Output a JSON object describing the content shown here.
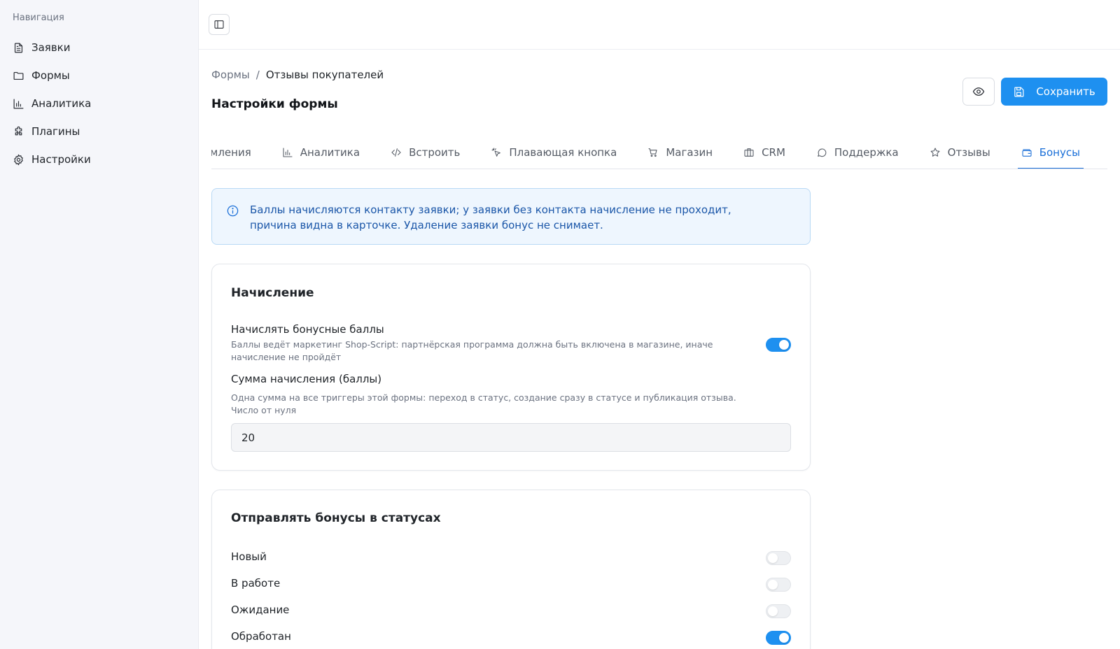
{
  "sidebar": {
    "title": "Навигация",
    "items": [
      {
        "label": "Заявки",
        "icon": "document-icon"
      },
      {
        "label": "Формы",
        "icon": "folder-icon"
      },
      {
        "label": "Аналитика",
        "icon": "bar-chart-icon"
      },
      {
        "label": "Плагины",
        "icon": "puzzle-icon"
      },
      {
        "label": "Настройки",
        "icon": "gear-icon"
      }
    ]
  },
  "header": {
    "breadcrumb": {
      "parent": "Формы",
      "separator": "/",
      "current": "Отзывы покупателей"
    },
    "title": "Настройки формы",
    "save_label": "Сохранить"
  },
  "tabs": [
    {
      "label": "мления",
      "icon": ""
    },
    {
      "label": "Аналитика",
      "icon": "bar-chart-icon"
    },
    {
      "label": "Встроить",
      "icon": "code-icon"
    },
    {
      "label": "Плавающая кнопка",
      "icon": "pointer-click-icon"
    },
    {
      "label": "Магазин",
      "icon": "cart-icon"
    },
    {
      "label": "CRM",
      "icon": "briefcase-icon"
    },
    {
      "label": "Поддержка",
      "icon": "chat-bubble-icon"
    },
    {
      "label": "Отзывы",
      "icon": "star-icon"
    },
    {
      "label": "Бонусы",
      "icon": "wallet-icon",
      "active": true
    }
  ],
  "alert": {
    "line1": "Баллы начисляются контакту заявки; у заявки без контакта начисление не проходит,",
    "line2": "причина видна в карточке. Удаление заявки бонус не снимает."
  },
  "accrual": {
    "title": "Начисление",
    "enable_label": "Начислять бонусные баллы",
    "enable_help_1": "Баллы ведёт маркетинг Shop-Script: партнёрская программа должна быть включена в магазине, иначе",
    "enable_help_2": "начисление не пройдёт",
    "enable_on": true,
    "amount_label": "Сумма начисления (баллы)",
    "amount_help_1": "Одна сумма на все триггеры этой формы: переход в статус, создание сразу в статусе и публикация отзыва.",
    "amount_help_2": "Число от нуля",
    "amount_value": "20"
  },
  "statuses": {
    "title": "Отправлять бонусы в статусах",
    "items": [
      {
        "label": "Новый",
        "on": false
      },
      {
        "label": "В работе",
        "on": false
      },
      {
        "label": "Ожидание",
        "on": false
      },
      {
        "label": "Обработан",
        "on": true
      }
    ]
  },
  "colors": {
    "accent": "#1e90f0",
    "active_tab": "#1a6fd8",
    "alert_bg": "#eef6fe"
  }
}
